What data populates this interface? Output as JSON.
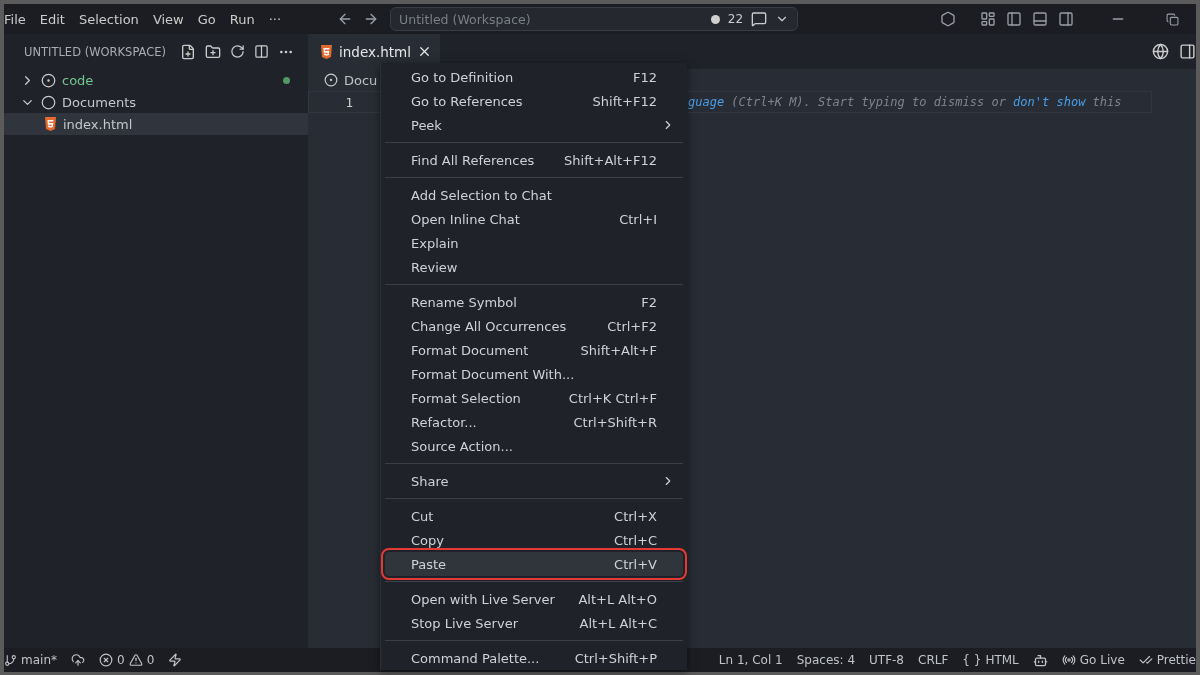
{
  "menu_bar": [
    "File",
    "Edit",
    "Selection",
    "View",
    "Go",
    "Run",
    "···"
  ],
  "command_center": {
    "placeholder": "Untitled (Workspace)",
    "count": "22"
  },
  "sidebar": {
    "title": "UNTITLED (WORKSPACE)",
    "tree": [
      {
        "label": "code",
        "kind": "folder",
        "expanded": false,
        "selected": false,
        "modified": true
      },
      {
        "label": "Documents",
        "kind": "folder",
        "expanded": true,
        "selected": false,
        "modified": false,
        "children": [
          {
            "label": "index.html",
            "kind": "file",
            "selected": true,
            "modified": false
          }
        ]
      }
    ]
  },
  "tabs": [
    {
      "label": "index.html",
      "selected": true
    }
  ],
  "breadcrumb": "Docu",
  "editor": {
    "line_number": "1",
    "hint": [
      {
        "kind": "link",
        "text": "guage"
      },
      {
        "kind": "text",
        "text": " (Ctrl+K M). Start typing to dismiss or "
      },
      {
        "kind": "link",
        "text": "don't show"
      },
      {
        "kind": "text",
        "text": " this"
      }
    ]
  },
  "context_menu": [
    [
      {
        "label": "Go to Definition",
        "shortcut": "F12",
        "submenu": false,
        "selected": false
      },
      {
        "label": "Go to References",
        "shortcut": "Shift+F12",
        "submenu": false,
        "selected": false
      },
      {
        "label": "Peek",
        "submenu": true,
        "selected": false
      }
    ],
    [
      {
        "label": "Find All References",
        "shortcut": "Shift+Alt+F12",
        "submenu": false,
        "selected": false
      }
    ],
    [
      {
        "label": "Add Selection to Chat",
        "submenu": false,
        "selected": false
      },
      {
        "label": "Open Inline Chat",
        "shortcut": "Ctrl+I",
        "submenu": false,
        "selected": false
      },
      {
        "label": "Explain",
        "submenu": false,
        "selected": false
      },
      {
        "label": "Review",
        "submenu": false,
        "selected": false
      }
    ],
    [
      {
        "label": "Rename Symbol",
        "shortcut": "F2",
        "submenu": false,
        "selected": false
      },
      {
        "label": "Change All Occurrences",
        "shortcut": "Ctrl+F2",
        "submenu": false,
        "selected": false
      },
      {
        "label": "Format Document",
        "shortcut": "Shift+Alt+F",
        "submenu": false,
        "selected": false
      },
      {
        "label": "Format Document With...",
        "submenu": false,
        "selected": false
      },
      {
        "label": "Format Selection",
        "shortcut": "Ctrl+K Ctrl+F",
        "submenu": false,
        "selected": false
      },
      {
        "label": "Refactor...",
        "shortcut": "Ctrl+Shift+R",
        "submenu": false,
        "selected": false
      },
      {
        "label": "Source Action...",
        "submenu": false,
        "selected": false
      }
    ],
    [
      {
        "label": "Share",
        "submenu": true,
        "selected": false
      }
    ],
    [
      {
        "label": "Cut",
        "shortcut": "Ctrl+X",
        "submenu": false,
        "selected": false
      },
      {
        "label": "Copy",
        "shortcut": "Ctrl+C",
        "submenu": false,
        "selected": false
      },
      {
        "label": "Paste",
        "shortcut": "Ctrl+V",
        "submenu": false,
        "selected": true
      }
    ],
    [
      {
        "label": "Open with Live Server",
        "shortcut": "Alt+L Alt+O",
        "submenu": false,
        "selected": false
      },
      {
        "label": "Stop Live Server",
        "shortcut": "Alt+L Alt+C",
        "submenu": false,
        "selected": false
      }
    ],
    [
      {
        "label": "Command Palette...",
        "shortcut": "Ctrl+Shift+P",
        "submenu": false,
        "selected": false
      }
    ]
  ],
  "status_bar": {
    "branch": "main*",
    "errors": "0",
    "warnings": "0",
    "position": "Ln 1, Col 1",
    "spaces": "Spaces: 4",
    "encoding": "UTF-8",
    "eol": "CRLF",
    "language_braces": "{ }",
    "language": "HTML",
    "go_live": "Go Live",
    "prettier": "Prettie"
  }
}
